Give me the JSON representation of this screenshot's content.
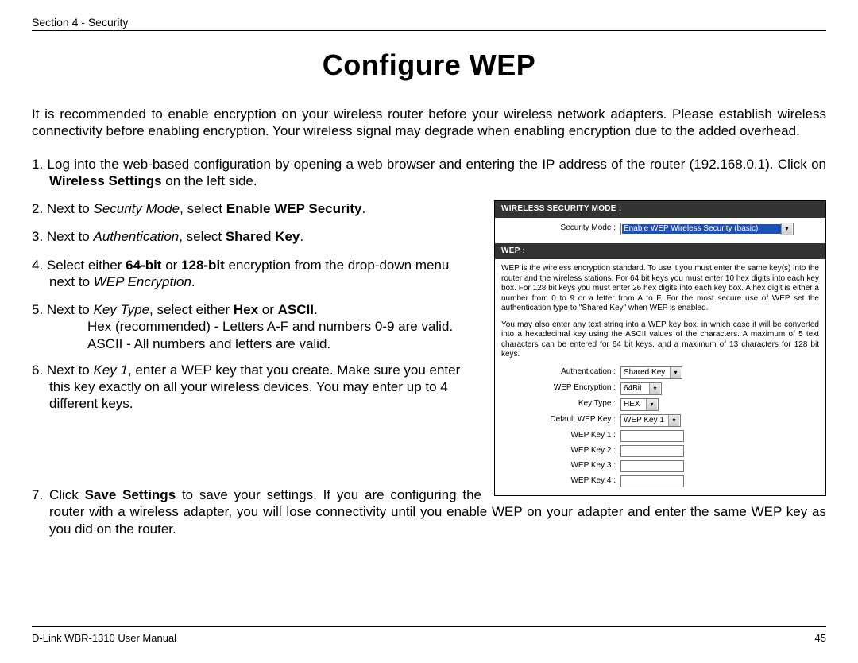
{
  "header": {
    "section": "Section 4 - Security"
  },
  "title": "Configure WEP",
  "intro": "It is recommended to enable encryption on your wireless router before your wireless network adapters. Please establish wireless connectivity before enabling encryption. Your wireless signal may degrade when enabling encryption due to the added overhead.",
  "steps": {
    "s1a": "1. Log into the web-based configuration by opening a web browser and entering the IP address of the router (192.168.0.1). Click on ",
    "s1b": "Wireless Settings",
    "s1c": " on the left side.",
    "s2a": "2. Next to ",
    "s2i": "Security Mode",
    "s2b": ", select ",
    "s2bold": "Enable WEP Security",
    "s2c": ".",
    "s3a": "3. Next to ",
    "s3i": "Authentication",
    "s3b": ", select ",
    "s3bold": "Shared Key",
    "s3c": ".",
    "s4a": "4. Select either ",
    "s4bold1": "64-bit",
    "s4mid": " or ",
    "s4bold2": "128-bit",
    "s4b": " encryption from the drop-down menu next to ",
    "s4i": "WEP Encryption",
    "s4c": ".",
    "s5a": "5. Next to ",
    "s5i": "Key Type",
    "s5b": ", select either ",
    "s5bold1": "Hex",
    "s5mid": " or ",
    "s5bold2": "ASCII",
    "s5c": ".",
    "s5sub1": "Hex (recommended) - Letters A-F and numbers 0-9 are valid.",
    "s5sub2": "ASCII - All numbers and letters are valid.",
    "s6a": "6. Next to ",
    "s6i": "Key 1",
    "s6b": ", enter a WEP key that you create. Make sure you enter this key exactly on all your wireless devices. You may enter up to 4 different keys.",
    "s7a": "7. Click ",
    "s7bold": "Save Settings",
    "s7b": " to save your settings. If you are configuring the router with a wireless adapter, you will lose connectivity until you enable WEP on your adapter and enter the same WEP key as you did on the router."
  },
  "screenshot": {
    "mode_header": "WIRELESS SECURITY MODE :",
    "mode_label": "Security Mode :",
    "mode_value": "Enable WEP Wireless Security (basic)",
    "wep_header": "WEP :",
    "wep_para1": "WEP is the wireless encryption standard. To use it you must enter the same key(s) into the router and the wireless stations. For 64 bit keys you must enter 10 hex digits into each key box. For 128 bit keys you must enter 26 hex digits into each key box. A hex digit is either a number from 0 to 9 or a letter from A to F. For the most secure use of WEP set the authentication type to \"Shared Key\" when WEP is enabled.",
    "wep_para2": "You may also enter any text string into a WEP key box, in which case it will be converted into a hexadecimal key using the ASCII values of the characters. A maximum of 5 text characters can be entered for 64 bit keys, and a maximum of 13 characters for 128 bit keys.",
    "fields": {
      "auth_label": "Authentication :",
      "auth_value": "Shared Key",
      "enc_label": "WEP Encryption :",
      "enc_value": "64Bit",
      "keytype_label": "Key Type :",
      "keytype_value": "HEX",
      "default_label": "Default WEP Key :",
      "default_value": "WEP Key 1",
      "k1": "WEP Key 1 :",
      "k2": "WEP Key 2 :",
      "k3": "WEP Key 3 :",
      "k4": "WEP Key 4 :"
    }
  },
  "footer": {
    "left": "D-Link WBR-1310 User Manual",
    "right": "45"
  }
}
